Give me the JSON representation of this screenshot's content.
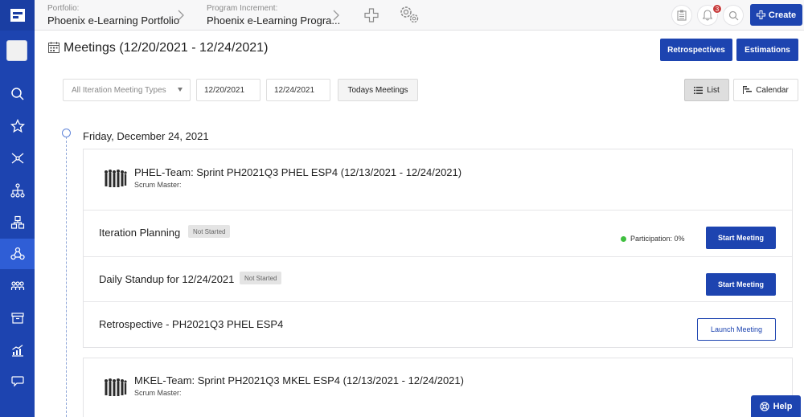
{
  "topbar": {
    "portfolio_label": "Portfolio:",
    "portfolio_value": "Phoenix e-Learning Portfolio",
    "pi_label": "Program Increment:",
    "pi_value": "Phoenix e-Learning Progra...",
    "notification_count": "3",
    "create_label": "Create"
  },
  "sidebar": {
    "items": [
      {
        "icon": "search-icon"
      },
      {
        "icon": "star-icon"
      },
      {
        "icon": "network-icon"
      },
      {
        "icon": "hierarchy-icon"
      },
      {
        "icon": "blocks-icon"
      },
      {
        "icon": "team-icon",
        "active": true
      },
      {
        "icon": "people-icon"
      },
      {
        "icon": "archive-icon"
      },
      {
        "icon": "chart-icon"
      },
      {
        "icon": "chat-icon"
      }
    ]
  },
  "page": {
    "title": "Meetings (12/20/2021 - 12/24/2021)",
    "retrospectives_label": "Retrospectives",
    "estimations_label": "Estimations"
  },
  "filters": {
    "meeting_type_placeholder": "All Iteration Meeting Types",
    "start_date": "12/20/2021",
    "end_date": "12/24/2021",
    "todays_meetings_label": "Todays Meetings",
    "list_label": "List",
    "calendar_label": "Calendar"
  },
  "day": {
    "title": "Friday, December 24, 2021"
  },
  "teams": [
    {
      "title": "PHEL-Team: Sprint PH2021Q3 PHEL ESP4 (12/13/2021 - 12/24/2021)",
      "subtitle": "Scrum Master:",
      "meetings": [
        {
          "title": "Iteration Planning",
          "status": "Not Started",
          "participation": "Participation: 0%",
          "action": "Start Meeting"
        },
        {
          "title": "Daily Standup for 12/24/2021",
          "status": "Not Started",
          "action": "Start Meeting"
        },
        {
          "title": "Retrospective - PH2021Q3 PHEL ESP4",
          "action": "Launch Meeting"
        }
      ]
    },
    {
      "title": "MKEL-Team: Sprint PH2021Q3 MKEL ESP4 (12/13/2021 - 12/24/2021)",
      "subtitle": "Scrum Master:"
    }
  ],
  "help_label": "Help",
  "colors": {
    "primary": "#1d44b0",
    "sidebar_active": "#2f5ed6",
    "participation_dot": "#3fbf3f"
  }
}
